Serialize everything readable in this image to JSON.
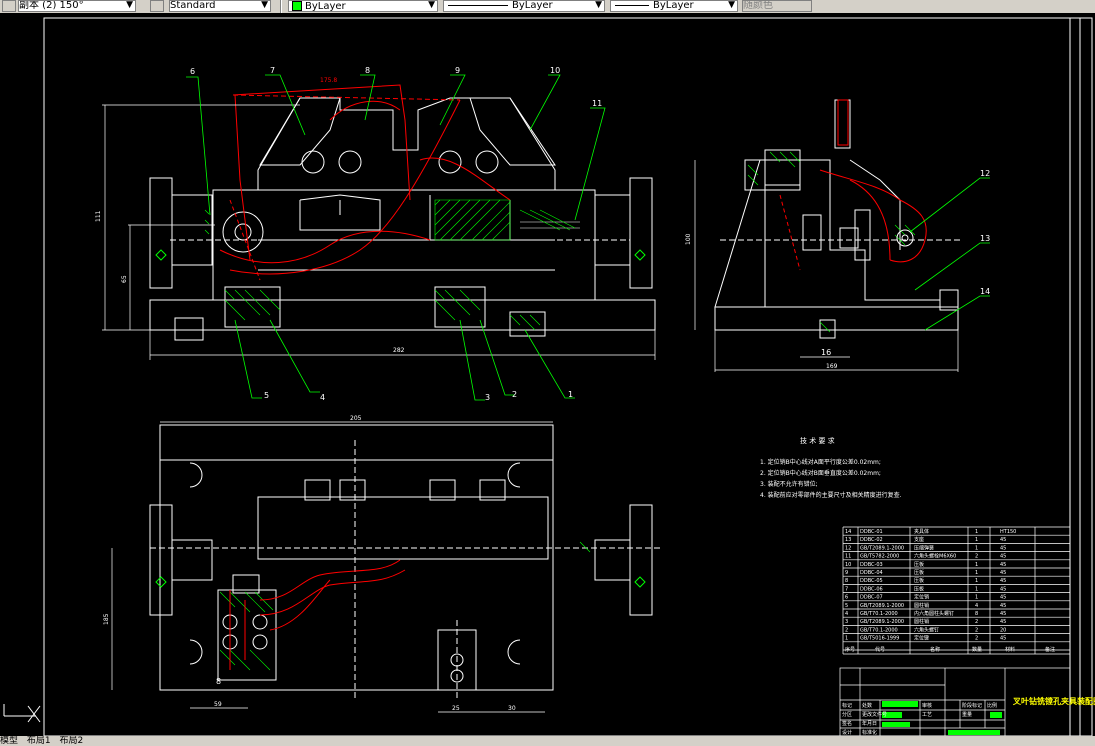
{
  "toolbar": {
    "dimstyle_value": "副本 (2) 150°",
    "textstyle_value": "Standard",
    "color_value": "ByLayer",
    "linetype_value": "ByLayer",
    "lineweight_value": "ByLayer",
    "plotstyle_value": "随颜色"
  },
  "drawing": {
    "part_numbers": [
      "1",
      "2",
      "3",
      "4",
      "5",
      "6",
      "7",
      "8",
      "9",
      "10",
      "11",
      "12",
      "13",
      "14"
    ],
    "dimensions": {
      "front_total_width": "282",
      "front_height": "111",
      "front_height_lower": "65",
      "top_width": "205",
      "side_width": "169",
      "side_height": "100",
      "side_small": "16",
      "top_height": "185",
      "top_small": "59",
      "top_dim_a": "25",
      "top_dim_b": "30",
      "dim_8": "8",
      "red_dim": "175.8"
    },
    "tech_req": {
      "title": "技 术 要 求",
      "lines": [
        "1. 定位销B中心线对A面平行度公差0.02mm;",
        "2. 定位销B中心线对B面垂直度公差0.02mm;",
        "3. 装配不允许有错位;",
        "4. 装配前应对零部件的主要尺寸及相关精度进行复查."
      ]
    },
    "bom": {
      "rows": [
        {
          "no": "14",
          "code": "DDBC-01",
          "name": "夹具体",
          "qty": "1",
          "mat": "HT150"
        },
        {
          "no": "13",
          "code": "DDBC-02",
          "name": "支座",
          "qty": "1",
          "mat": "45"
        },
        {
          "no": "12",
          "code": "GB/T2089.1-2000",
          "name": "压缩弹簧",
          "qty": "1",
          "mat": "45"
        },
        {
          "no": "11",
          "code": "GB/T5782-2000",
          "name": "六角头螺栓M6X60",
          "qty": "2",
          "mat": "45"
        },
        {
          "no": "10",
          "code": "DDBC-03",
          "name": "压板",
          "qty": "1",
          "mat": "45"
        },
        {
          "no": "9",
          "code": "DDBC-04",
          "name": "压板",
          "qty": "1",
          "mat": "45"
        },
        {
          "no": "8",
          "code": "DDBC-05",
          "name": "压板",
          "qty": "1",
          "mat": "45"
        },
        {
          "no": "7",
          "code": "DDBC-06",
          "name": "压板",
          "qty": "1",
          "mat": "45"
        },
        {
          "no": "6",
          "code": "DDBC-07",
          "name": "定位销",
          "qty": "1",
          "mat": "45"
        },
        {
          "no": "5",
          "code": "GB/T2089.1-2000",
          "name": "圆柱销",
          "qty": "4",
          "mat": "45"
        },
        {
          "no": "4",
          "code": "GB/T70.1-2000",
          "name": "内六角圆柱头螺钉",
          "qty": "8",
          "mat": "45"
        },
        {
          "no": "3",
          "code": "GB/T2089.1-2000",
          "name": "圆柱销",
          "qty": "2",
          "mat": "45"
        },
        {
          "no": "2",
          "code": "GB/T70.1-2000",
          "name": "六角头螺钉",
          "qty": "2",
          "mat": "20"
        },
        {
          "no": "1",
          "code": "GB/T5016-1999",
          "name": "定位键",
          "qty": "2",
          "mat": "45"
        }
      ],
      "header": {
        "no": "序号",
        "code": "代号",
        "name": "名称",
        "qty": "数量",
        "mat": "材料",
        "note": "备注"
      }
    },
    "title_block": {
      "title": "叉叶钻铣镗孔夹具装配图",
      "labels": [
        "标记",
        "处数",
        "分区",
        "更改文件号",
        "签名",
        "年月日",
        "设计",
        "标准化",
        "审核",
        "工艺",
        "阶段标记",
        "重量",
        "比例"
      ]
    }
  },
  "tabs": {
    "model": "模型",
    "layout1": "布局1",
    "layout2": "布局2"
  },
  "colors": {
    "background": "#000000",
    "drawing_main": "#ffffff",
    "leaders": "#00ff00",
    "section_lines": "#ff0000",
    "toolbar": "#d4d0c8",
    "swatch": "#00ff00"
  }
}
